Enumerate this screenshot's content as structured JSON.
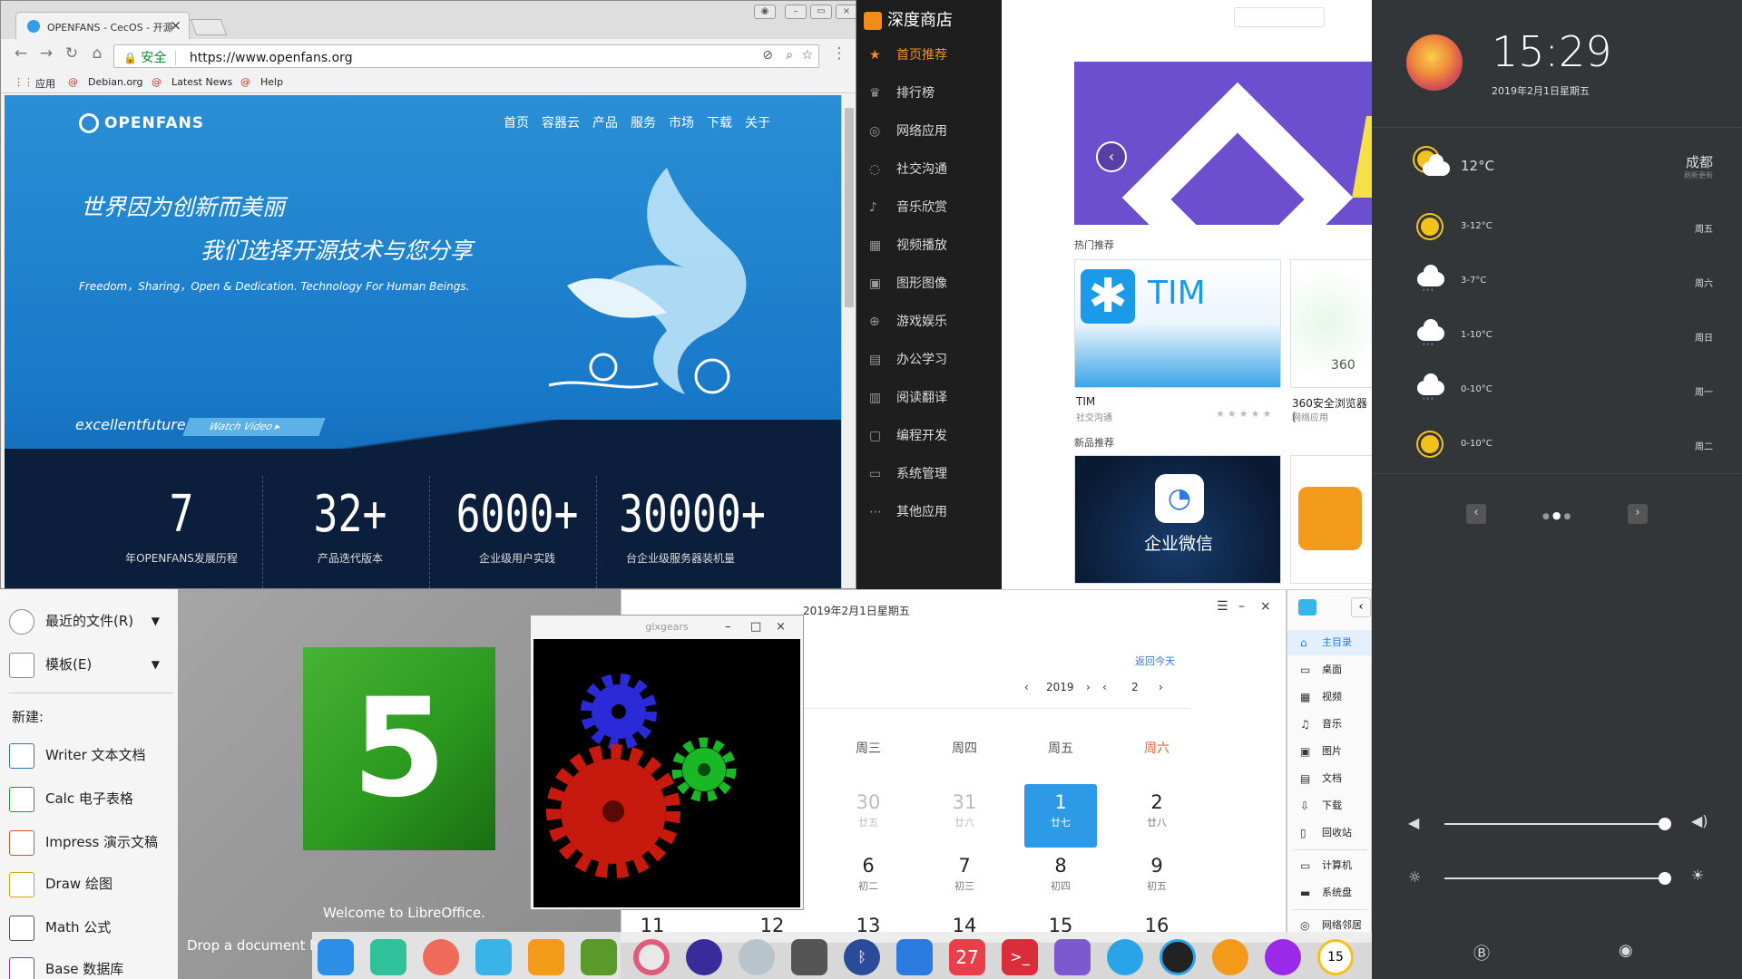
{
  "browser": {
    "tab_title": "OPENFANS - CecOS - 开源",
    "url_secure": "安全",
    "url": "https://www.openfans.org",
    "bookmarks": [
      "应用",
      "Debian.org",
      "Latest News",
      "Help"
    ],
    "site": {
      "logo": "OPENFANS",
      "nav": [
        "首页",
        "容器云",
        "产品",
        "服务",
        "市场",
        "下载",
        "关于"
      ],
      "hero_line1": "世界因为创新而美丽",
      "hero_line2": "我们选择开源技术与您分享",
      "hero_line3": "Freedom，Sharing，Open & Dedication. Technology For Human Beings.",
      "excellent": "excellentfuture",
      "watch": "Watch Video",
      "stats": [
        {
          "num": "7",
          "label": "年OPENFANS发展历程"
        },
        {
          "num": "32+",
          "label": "产品迭代版本"
        },
        {
          "num": "6000+",
          "label": "企业级用户实践"
        },
        {
          "num": "30000+",
          "label": "台企业级服务器装机量"
        }
      ]
    }
  },
  "store": {
    "title": "深度商店",
    "menu": [
      "首页推荐",
      "排行榜",
      "网络应用",
      "社交沟通",
      "音乐欣赏",
      "视频播放",
      "图形图像",
      "游戏娱乐",
      "办公学习",
      "阅读翻译",
      "编程开发",
      "系统管理",
      "其他应用"
    ],
    "hot_label": "热门推荐",
    "new_label": "新品推荐",
    "apps": [
      {
        "name": "TIM",
        "category": "社交沟通",
        "logo": "TIM"
      },
      {
        "name": "360安全浏览器 (",
        "category": "网络应用",
        "logo": "360"
      }
    ],
    "new_app": "企业微信"
  },
  "panel": {
    "time": "15:29",
    "date": "2019年2月1日星期五",
    "city": "成都",
    "city_sub": "刷新更新",
    "current_temp": "12°C",
    "forecast": [
      {
        "temp": "3-12°C",
        "day": "周五",
        "icon": "sun"
      },
      {
        "temp": "3-7°C",
        "day": "周六",
        "icon": "rain"
      },
      {
        "temp": "1-10°C",
        "day": "周日",
        "icon": "rain"
      },
      {
        "temp": "0-10°C",
        "day": "周一",
        "icon": "rain"
      },
      {
        "temp": "0-10°C",
        "day": "周二",
        "icon": "sun"
      }
    ],
    "volume_level": 1.0,
    "brightness_level": 1.0
  },
  "libreoffice": {
    "recent": "最近的文件(R)",
    "templates": "模板(E)",
    "new_label": "新建:",
    "items": [
      "Writer 文本文档",
      "Calc 电子表格",
      "Impress 演示文稿",
      "Draw 绘图",
      "Math 公式",
      "Base 数据库"
    ],
    "logo_number": "5",
    "welcome": "Welcome to LibreOffice.",
    "drop": "Drop a document here"
  },
  "glxgears": {
    "title": "glxgears"
  },
  "calendar": {
    "title": "2019年2月1日星期五",
    "back_today": "返回今天",
    "year": "2019",
    "month": "2",
    "weekdays": [
      "周三",
      "周四",
      "周五",
      "周六"
    ],
    "row1": [
      {
        "n": "30",
        "l": "廿五",
        "grey": true
      },
      {
        "n": "31",
        "l": "廿六",
        "grey": true
      },
      {
        "n": "1",
        "l": "廿七",
        "sel": true
      },
      {
        "n": "2",
        "l": "廿八"
      }
    ],
    "row2": [
      {
        "n": "6",
        "l": "初二"
      },
      {
        "n": "7",
        "l": "初三"
      },
      {
        "n": "8",
        "l": "初四"
      },
      {
        "n": "9",
        "l": "初五"
      }
    ],
    "row3": [
      "11",
      "12",
      "13",
      "14",
      "15",
      "16"
    ]
  },
  "filemanager": {
    "items": [
      "主目录",
      "桌面",
      "视频",
      "音乐",
      "图片",
      "文档",
      "下载",
      "回收站",
      "计算机",
      "系统盘",
      "网络邻居"
    ]
  },
  "dock": {
    "calendar_day": "27",
    "clock": "15"
  }
}
